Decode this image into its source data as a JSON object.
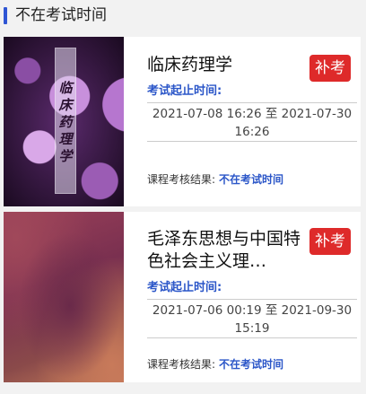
{
  "section": {
    "title": "不在考试时间"
  },
  "colors": {
    "accent_blue": "#2b56c8",
    "makeup_red": "#de2a2a",
    "section_bar": "#2f55d4"
  },
  "courses": [
    {
      "title": "临床药理学",
      "cover_text": "临床药理学",
      "makeup_label": "补考",
      "time_label": "考试起止时间:",
      "time_range": "2021-07-08 16:26 至 2021-07-30 16:26",
      "result_label": "课程考核结果:",
      "result_value": "不在考试时间"
    },
    {
      "title": "毛泽东思想与中国特色社会主义理…",
      "makeup_label": "补考",
      "time_label": "考试起止时间:",
      "time_range": "2021-07-06 00:19 至 2021-09-30 15:19",
      "result_label": "课程考核结果:",
      "result_value": "不在考试时间"
    }
  ]
}
